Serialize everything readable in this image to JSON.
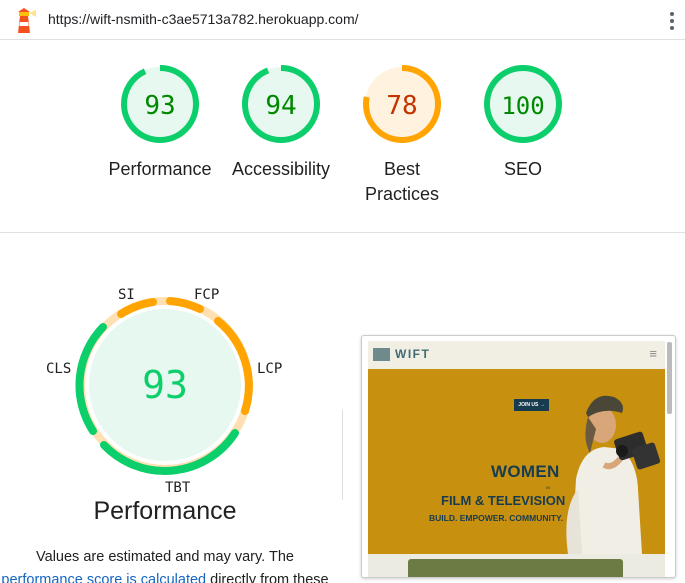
{
  "topbar": {
    "url": "https://wift-nsmith-c3ae5713a782.herokuapp.com/",
    "logo_icon": "lighthouse-icon",
    "menu_icon": "more-vert-icon"
  },
  "colors": {
    "pass": "#0cce6b",
    "pass_text": "#008800",
    "pass_bg": "#e6f8ef",
    "average": "#ffa400",
    "average_text": "#c33300",
    "average_bg": "#fff3e0"
  },
  "gauges": [
    {
      "score": "93",
      "label": "Performance",
      "status": "pass"
    },
    {
      "score": "94",
      "label": "Accessibility",
      "status": "pass"
    },
    {
      "score": "78",
      "label_line1": "Best",
      "label_line2": "Practices",
      "status": "average"
    },
    {
      "score": "100",
      "label": "SEO",
      "status": "pass"
    }
  ],
  "performance": {
    "score": "93",
    "title": "Performance",
    "metrics": {
      "si": "SI",
      "fcp": "FCP",
      "lcp": "LCP",
      "tbt": "TBT",
      "cls": "CLS"
    },
    "note_line1": "Values are estimated and may vary. The",
    "note_link": "performance score is calculated",
    "note_line2_rest": " directly from these"
  },
  "screenshot": {
    "logo": "WIFT",
    "menu_icon": "hamburger-icon",
    "join_button": "JOIN US →",
    "headline_women": "WOMEN",
    "headline_in": "IN",
    "headline_film": "FILM & TELEVISION",
    "tagline": "BUILD. EMPOWER. COMMUNITY."
  }
}
